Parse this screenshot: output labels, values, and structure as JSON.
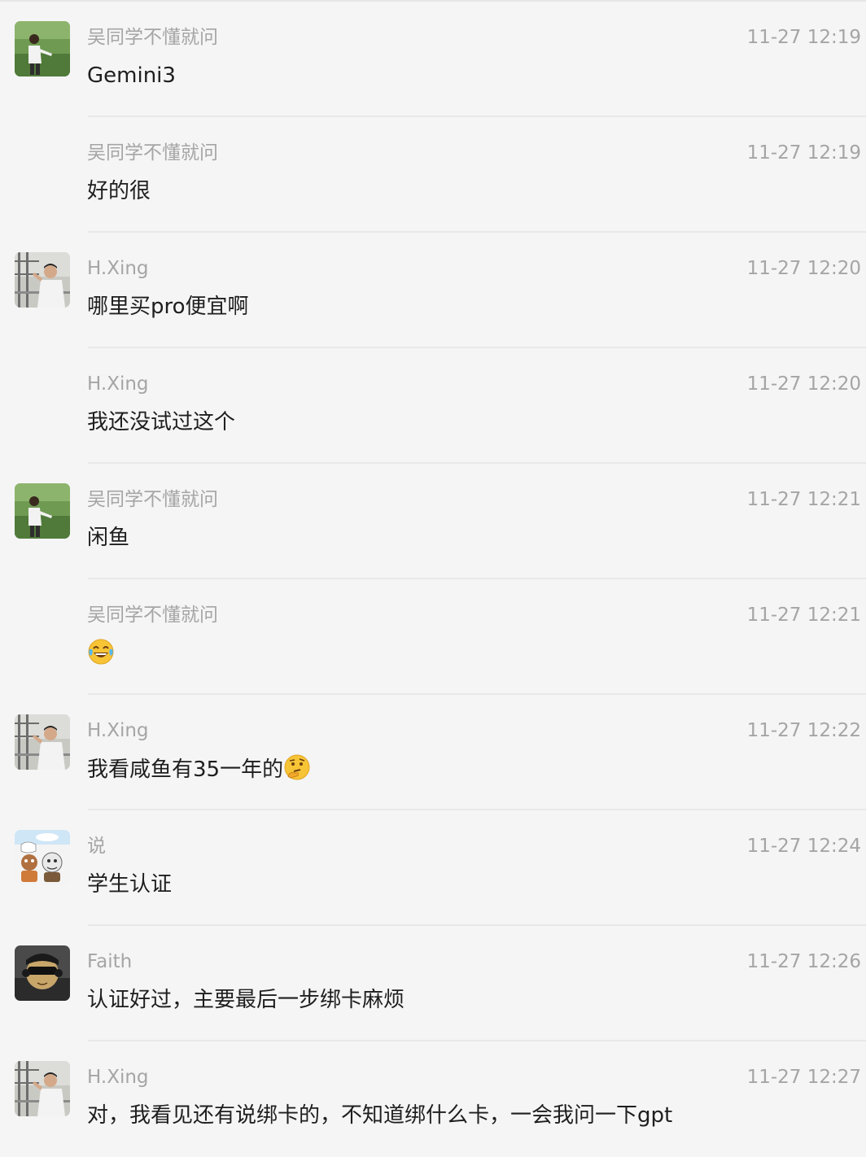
{
  "messages": [
    {
      "sender": "吴同学不懂就问",
      "time": "11-27 12:19",
      "text": "Gemini3",
      "avatar": "wu",
      "show_avatar": true
    },
    {
      "sender": "吴同学不懂就问",
      "time": "11-27 12:19",
      "text": "好的很",
      "avatar": "wu",
      "show_avatar": false
    },
    {
      "sender": "H.Xing",
      "time": "11-27 12:20",
      "text": "哪里买pro便宜啊",
      "avatar": "hxing",
      "show_avatar": true
    },
    {
      "sender": "H.Xing",
      "time": "11-27 12:20",
      "text": "我还没试过这个",
      "avatar": "hxing",
      "show_avatar": false
    },
    {
      "sender": "吴同学不懂就问",
      "time": "11-27 12:21",
      "text": "闲鱼",
      "avatar": "wu",
      "show_avatar": true
    },
    {
      "sender": "吴同学不懂就问",
      "time": "11-27 12:21",
      "text": "",
      "emoji": "tears-of-joy-emoji",
      "avatar": "wu",
      "show_avatar": false
    },
    {
      "sender": "H.Xing",
      "time": "11-27 12:22",
      "text": "我看咸鱼有35一年的",
      "emoji_after": "thinking-emoji",
      "avatar": "hxing",
      "show_avatar": true
    },
    {
      "sender": "说",
      "time": "11-27 12:24",
      "text": "学生认证",
      "avatar": "shuo",
      "show_avatar": true
    },
    {
      "sender": "Faith",
      "time": "11-27 12:26",
      "text": "认证好过，主要最后一步绑卡麻烦",
      "avatar": "faith",
      "show_avatar": true
    },
    {
      "sender": "H.Xing",
      "time": "11-27 12:27",
      "text": "对，我看见还有说绑卡的，不知道绑什么卡，一会我问一下gpt",
      "avatar": "hxing",
      "show_avatar": true
    }
  ]
}
